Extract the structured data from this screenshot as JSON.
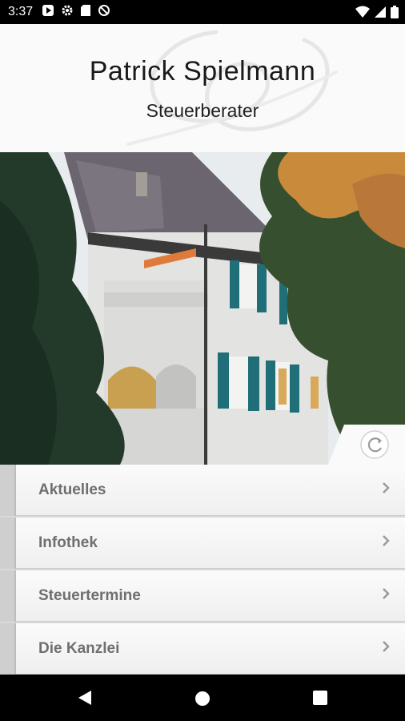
{
  "status_bar": {
    "time": "3:37",
    "left_icons": [
      "play-icon",
      "gear-icon",
      "sd-card-icon",
      "no-sync-icon"
    ],
    "right_icons": [
      "wifi-icon",
      "signal-icon",
      "battery-icon"
    ]
  },
  "header": {
    "name": "Patrick Spielmann",
    "subtitle": "Steuerberater"
  },
  "hero": {
    "image": "villa-photo",
    "refresh_icon": "refresh-icon"
  },
  "menu": {
    "items": [
      {
        "label": "Aktuelles"
      },
      {
        "label": "Infothek"
      },
      {
        "label": "Steuertermine"
      },
      {
        "label": "Die Kanzlei"
      }
    ]
  },
  "nav_bar": {
    "buttons": [
      "back-icon",
      "home-icon",
      "recents-icon"
    ]
  }
}
